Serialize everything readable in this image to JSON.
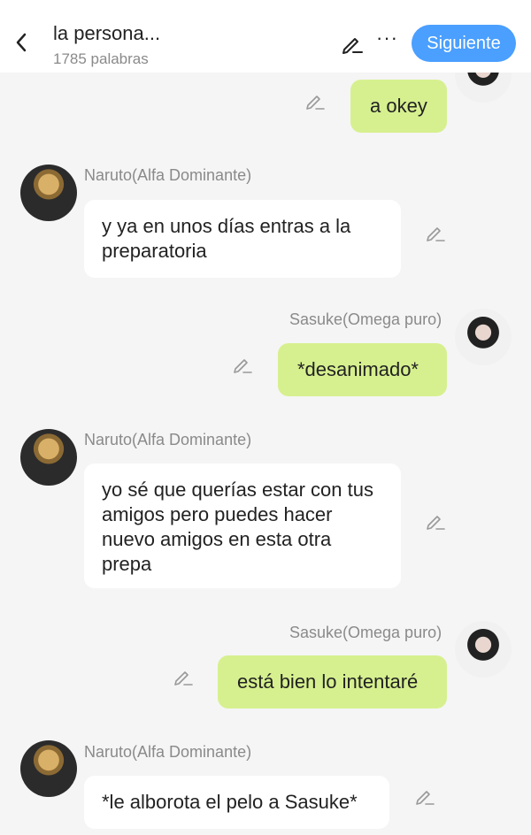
{
  "header": {
    "title": "la persona...",
    "word_count": "1785 palabras",
    "next_label": "Siguiente",
    "more_label": "···",
    "accent_color": "#4a9fff"
  },
  "messages": [
    {
      "side": "right",
      "text": "a okey"
    },
    {
      "side": "left",
      "author": "Naruto(Alfa Dominante)",
      "text": "y ya en unos días entras a la preparatoria"
    },
    {
      "side": "right",
      "author": "Sasuke(Omega puro)",
      "text": "*desanimado*"
    },
    {
      "side": "left",
      "author": "Naruto(Alfa Dominante)",
      "text": "yo sé que querías estar con tus amigos pero puedes hacer nuevo amigos en esta otra prepa"
    },
    {
      "side": "right",
      "author": "Sasuke(Omega puro)",
      "text": "está bien lo intentaré"
    },
    {
      "side": "left",
      "author": "Naruto(Alfa Dominante)",
      "text": "*le alborota el pelo a Sasuke*"
    }
  ],
  "colors": {
    "sent_bubble": "#d6f08f",
    "received_bubble": "#ffffff",
    "background": "#f5f5f5"
  }
}
